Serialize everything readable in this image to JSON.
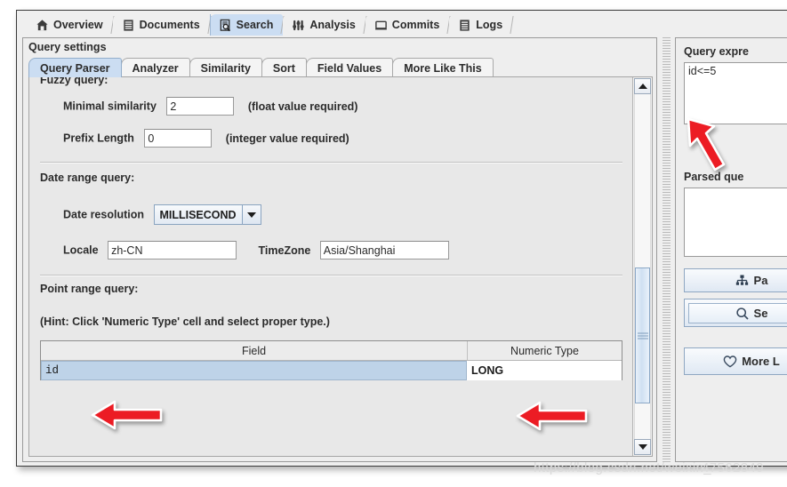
{
  "window": {
    "main_tabs": [
      {
        "label": "Overview",
        "icon": "home-icon",
        "selected": false
      },
      {
        "label": "Documents",
        "icon": "document-icon",
        "selected": false
      },
      {
        "label": "Search",
        "icon": "search-document-icon",
        "selected": true
      },
      {
        "label": "Analysis",
        "icon": "analysis-icon",
        "selected": false
      },
      {
        "label": "Commits",
        "icon": "commits-icon",
        "selected": false
      },
      {
        "label": "Logs",
        "icon": "logs-icon",
        "selected": false
      }
    ]
  },
  "query_settings": {
    "title": "Query settings",
    "sub_tabs": [
      {
        "label": "Query Parser",
        "selected": true
      },
      {
        "label": "Analyzer",
        "selected": false
      },
      {
        "label": "Similarity",
        "selected": false
      },
      {
        "label": "Sort",
        "selected": false
      },
      {
        "label": "Field Values",
        "selected": false
      },
      {
        "label": "More Like This",
        "selected": false
      }
    ],
    "fuzzy": {
      "section_label": "Fuzzy query:",
      "minimal_similarity_label": "Minimal similarity",
      "minimal_similarity_value": "2",
      "minimal_similarity_hint": "(float value required)",
      "prefix_length_label": "Prefix Length",
      "prefix_length_value": "0",
      "prefix_length_hint": "(integer value required)"
    },
    "date_range": {
      "section_label": "Date range query:",
      "date_resolution_label": "Date resolution",
      "date_resolution_value": "MILLISECOND",
      "locale_label": "Locale",
      "locale_value": "zh-CN",
      "timezone_label": "TimeZone",
      "timezone_value": "Asia/Shanghai"
    },
    "point_range": {
      "section_label": "Point range query:",
      "hint": "(Hint: Click 'Numeric Type' cell and select proper type.)",
      "columns": [
        "Field",
        "Numeric Type"
      ],
      "rows": [
        {
          "field": "id",
          "numeric_type": "LONG"
        }
      ]
    }
  },
  "right_panel": {
    "query_expression_label": "Query expre",
    "query_expression_value": "id<=5",
    "parsed_query_label": "Parsed que",
    "parsed_query_value": "",
    "parse_button": "Pa",
    "search_button": "Se",
    "more_like_this_button": "More L",
    "icons": {
      "parse": "hierarchy-icon",
      "search": "magnifier-icon",
      "more_like_this": "heart-icon"
    }
  },
  "annotations": {
    "arrows": [
      {
        "name": "arrow-to-query-expression",
        "direction": "up-left"
      },
      {
        "name": "arrow-to-field-id",
        "direction": "left"
      },
      {
        "name": "arrow-to-numeric-type-long",
        "direction": "left"
      }
    ],
    "arrow_color": "#ec1c24"
  },
  "watermark": {
    "text": "https://blog.csdn.net/weixin_",
    "overlap": "47562849"
  }
}
